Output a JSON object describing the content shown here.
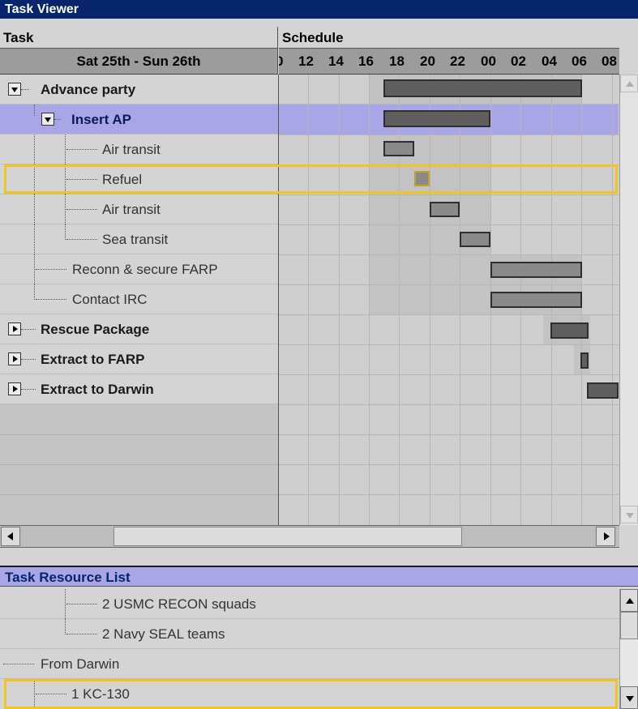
{
  "window": {
    "title": "Task Viewer"
  },
  "columns": {
    "task": "Task",
    "schedule": "Schedule"
  },
  "date_range": "Sat 25th - Sun 26th",
  "time_ticks": [
    "0",
    "12",
    "14",
    "16",
    "18",
    "20",
    "22",
    "00",
    "02",
    "04",
    "06",
    "08"
  ],
  "tasks": [
    {
      "label": "Advance party",
      "level": 0,
      "expander": "expanded",
      "bold": true
    },
    {
      "label": "Insert AP",
      "level": 1,
      "expander": "expanded",
      "bold": true,
      "selected": true
    },
    {
      "label": "Air transit",
      "level": 2
    },
    {
      "label": "Refuel",
      "level": 2,
      "highlighted": true
    },
    {
      "label": "Air transit",
      "level": 2
    },
    {
      "label": "Sea transit",
      "level": 2
    },
    {
      "label": "Reconn & secure FARP",
      "level": 1
    },
    {
      "label": "Contact IRC",
      "level": 1
    },
    {
      "label": "Rescue Package",
      "level": 0,
      "expander": "collapsed",
      "bold": true
    },
    {
      "label": "Extract to FARP",
      "level": 0,
      "expander": "collapsed",
      "bold": true
    },
    {
      "label": "Extract to Darwin",
      "level": 0,
      "expander": "collapsed",
      "bold": true
    }
  ],
  "resource_list": {
    "title": "Task Resource List",
    "items": [
      {
        "label": "2 USMC RECON squads",
        "level": 2
      },
      {
        "label": "2 Navy SEAL teams",
        "level": 2
      },
      {
        "label": "From Darwin",
        "level": 0
      },
      {
        "label": "1 KC-130",
        "level": 1,
        "highlighted": true
      }
    ]
  },
  "colors": {
    "titlebar": "#06256b",
    "selection": "#a9a6e6",
    "highlight": "#f2c420",
    "bar": "#5f5f5f"
  }
}
